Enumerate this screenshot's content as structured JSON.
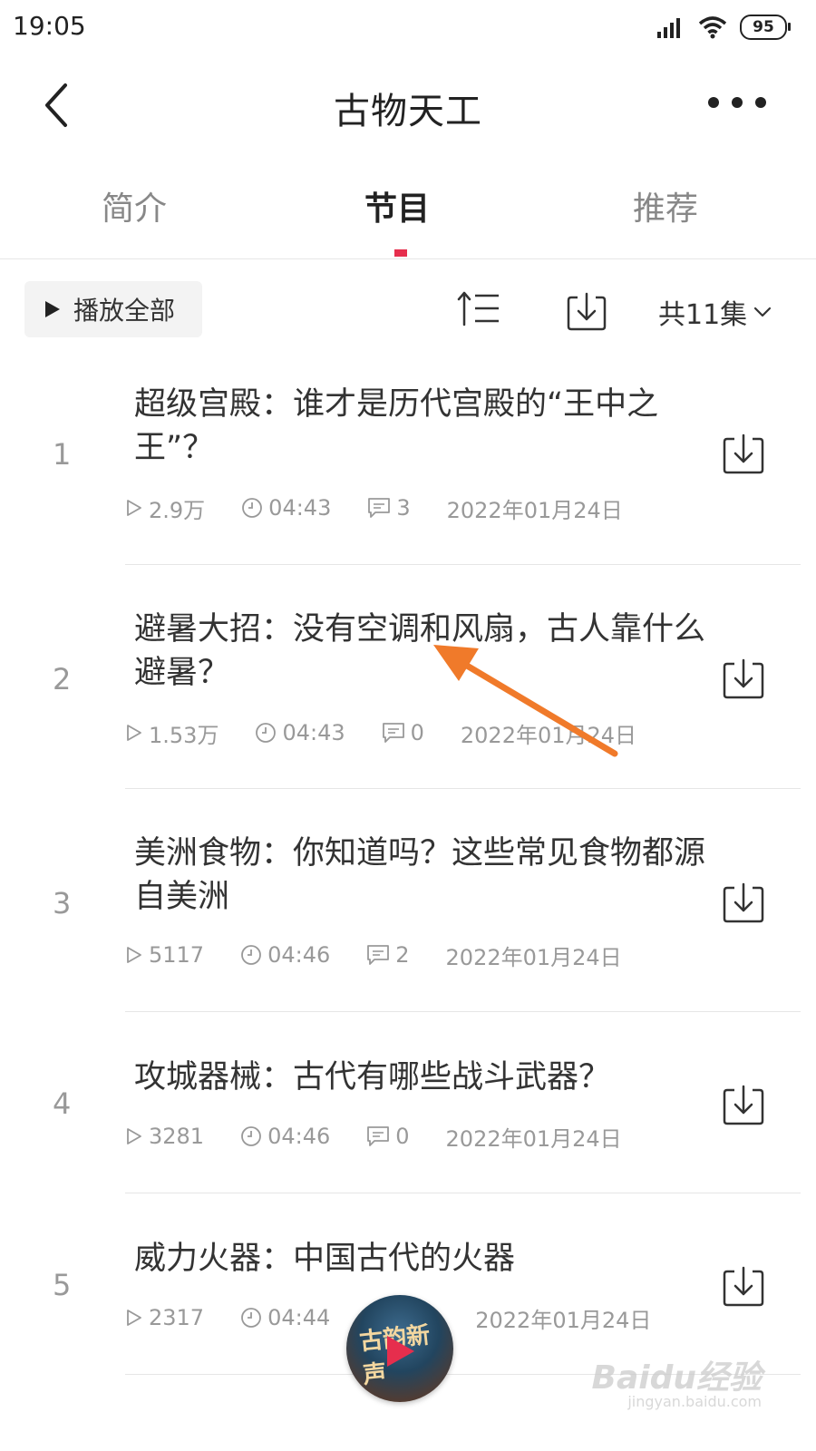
{
  "status_bar": {
    "time": "19:05",
    "battery": "95",
    "icons": [
      "signal-icon",
      "wifi-icon",
      "battery-icon"
    ]
  },
  "header": {
    "title": "古物天工",
    "back_icon": "chevron-left-icon",
    "more_icon": "more-icon"
  },
  "tabs": [
    {
      "label": "简介",
      "active": false
    },
    {
      "label": "节目",
      "active": true
    },
    {
      "label": "推荐",
      "active": false
    }
  ],
  "toolbar": {
    "play_all_label": "播放全部",
    "episode_count": "共11集",
    "sort_icon": "sort-icon",
    "download_icon": "download-icon"
  },
  "episodes": [
    {
      "index": "1",
      "title": "超级宫殿：谁才是历代宫殿的“王中之王”？",
      "plays": "2.9万",
      "duration": "04:43",
      "comments": "3",
      "date": "2022年01月24日"
    },
    {
      "index": "2",
      "title": "避暑大招：没有空调和风扇，古人靠什么避暑？",
      "plays": "1.53万",
      "duration": "04:43",
      "comments": "0",
      "date": "2022年01月24日"
    },
    {
      "index": "3",
      "title": "美洲食物：你知道吗？这些常见食物都源自美洲",
      "plays": "5117",
      "duration": "04:46",
      "comments": "2",
      "date": "2022年01月24日"
    },
    {
      "index": "4",
      "title": "攻城器械：古代有哪些战斗武器？",
      "plays": "3281",
      "duration": "04:46",
      "comments": "0",
      "date": "2022年01月24日"
    },
    {
      "index": "5",
      "title": "威力火器：中国古代的火器",
      "plays": "2317",
      "duration": "04:44",
      "comments": "",
      "date": "2022年01月24日"
    }
  ],
  "mini_player": {
    "cover_text": "古韵新声"
  },
  "watermark": {
    "text": "Baidu经验",
    "sub": "jingyan.baidu.com"
  },
  "colors": {
    "accent": "#e62e4d",
    "annotation": "#f07a2a",
    "muted": "#999999",
    "text": "#333333"
  }
}
